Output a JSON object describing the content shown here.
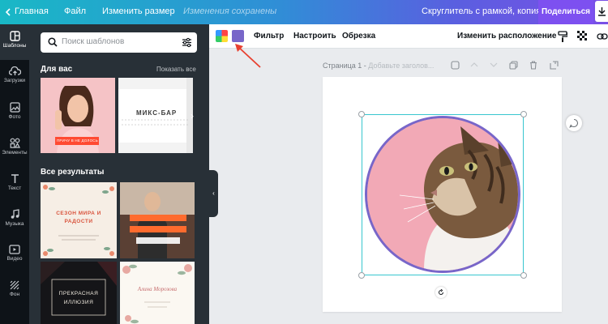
{
  "topbar": {
    "home": "Главная",
    "file": "Файл",
    "resize": "Изменить размер",
    "save_status": "Изменения сохранены",
    "design_title": "Скруглитель с рамкой, копия",
    "share": "Поделиться"
  },
  "rail": [
    {
      "label": "Шаблоны",
      "icon": "templates-icon"
    },
    {
      "label": "Загрузки",
      "icon": "upload-icon"
    },
    {
      "label": "Фото",
      "icon": "photo-icon"
    },
    {
      "label": "Элементы",
      "icon": "elements-icon"
    },
    {
      "label": "Текст",
      "icon": "text-icon"
    },
    {
      "label": "Музыка",
      "icon": "music-icon"
    },
    {
      "label": "Видео",
      "icon": "video-icon"
    },
    {
      "label": "Фон",
      "icon": "background-icon"
    }
  ],
  "panel": {
    "search_placeholder": "Поиск шаблонов",
    "for_you": "Для вас",
    "show_all": "Показать все",
    "all_results": "Все результаты",
    "thumb1_badge": "ПРИЧУ В НЕ ДОЛОСЬ",
    "thumb2_title": "МИКС-БАР",
    "thumb3_title": "СЕЗОН МИРА И РАДОСТИ",
    "thumb5_title": "ПРЕКРАСНАЯ ИЛЛЮЗИЯ",
    "thumb6_title": "Алина Морозова"
  },
  "toolbar": {
    "filter": "Фильтр",
    "adjust": "Настроить",
    "crop": "Обрезка",
    "arrange": "Изменить расположение",
    "swatch_color": "#7866c9"
  },
  "page": {
    "label": "Страница 1 - ",
    "add_title": "Добавьте заголов..."
  },
  "colors": {
    "accent": "#7d50f0",
    "selection": "#38c6cf",
    "frame_border": "#7866c9",
    "annotation_arrow": "#e8402f"
  }
}
